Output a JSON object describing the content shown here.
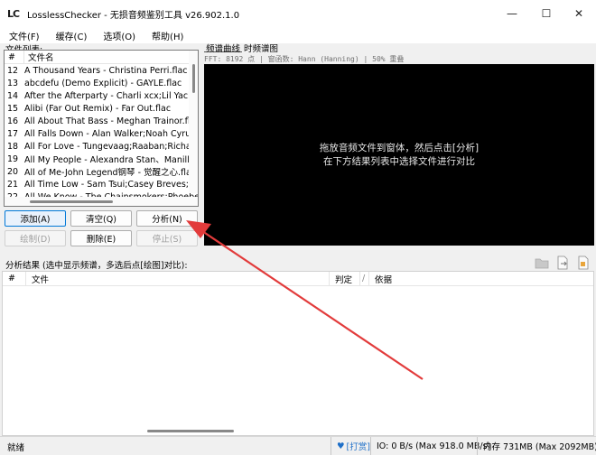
{
  "window": {
    "icon_text": "LC",
    "title": "LosslessChecker - 无损音频鉴别工具 v26.902.1.0",
    "minimize": "—",
    "maximize": "☐",
    "close": "✕"
  },
  "menu": [
    "文件(F)",
    "缓存(C)",
    "选项(O)",
    "帮助(H)"
  ],
  "filelist": {
    "label": "文件列表:",
    "col_num": "#",
    "col_name": "文件名",
    "rows": [
      {
        "num": "12",
        "name": "A Thousand Years - Christina Perri.flac"
      },
      {
        "num": "13",
        "name": "abcdefu (Demo Explicit) - GAYLE.flac"
      },
      {
        "num": "14",
        "name": "After the Afterparty - Charli xcx;Lil Yachty.flac"
      },
      {
        "num": "15",
        "name": "Alibi (Far Out Remix) - Far Out.flac"
      },
      {
        "num": "16",
        "name": "All About That Bass - Meghan Trainor.flac"
      },
      {
        "num": "17",
        "name": "All Falls Down - Alan Walker;Noah Cyrus;Digital Farm Animals"
      },
      {
        "num": "18",
        "name": "All For Love - Tungevaag;Raaban;Richard Smitt"
      },
      {
        "num": "19",
        "name": "All My People - Alexandra Stan、Manilla Maniacs"
      },
      {
        "num": "20",
        "name": "All of Me-John Legend钢琴 - 觉醒之心.flac"
      },
      {
        "num": "21",
        "name": "All Time Low - Sam Tsui;Casey Breves;Kurt Hugo Schneider"
      },
      {
        "num": "22",
        "name": "All We Know - The Chainsmokers;Phoebe Ryan"
      }
    ]
  },
  "buttons": {
    "add": "添加(A)",
    "clear": "清空(Q)",
    "analyze": "分析(N)",
    "draw": "绘制(D)",
    "delete": "删除(E)",
    "stop": "停止(S)"
  },
  "tabs": [
    "频谱曲线",
    "时频谱图"
  ],
  "fft_info": "FFT: 8192 点 | 窗函数: Hann (Hanning) | 50% 重叠",
  "canvas": {
    "line1": "拖放音频文件到窗体，然后点击[分析]",
    "line2": "在下方结果列表中选择文件进行对比"
  },
  "results": {
    "label": "分析结果 (选中显示频谱，多选后点[绘图]对比):",
    "col_num": "#",
    "col_file": "文件",
    "col_verdict": "判定",
    "col_basis": "依据",
    "sort_glyph": "/"
  },
  "icons": [
    "folder-icon",
    "export-icon",
    "report-icon",
    "heart-icon"
  ],
  "status": {
    "ready": "就绪",
    "heart": "♥",
    "donate": "[打赏]",
    "io": "IO: 0 B/s (Max 918.0 MB/s)",
    "memory": "内存 731MB (Max 2092MB)"
  },
  "colors": {
    "accent": "#0078d7",
    "arrow": "#e23b3b",
    "link": "#1e6fc8"
  }
}
